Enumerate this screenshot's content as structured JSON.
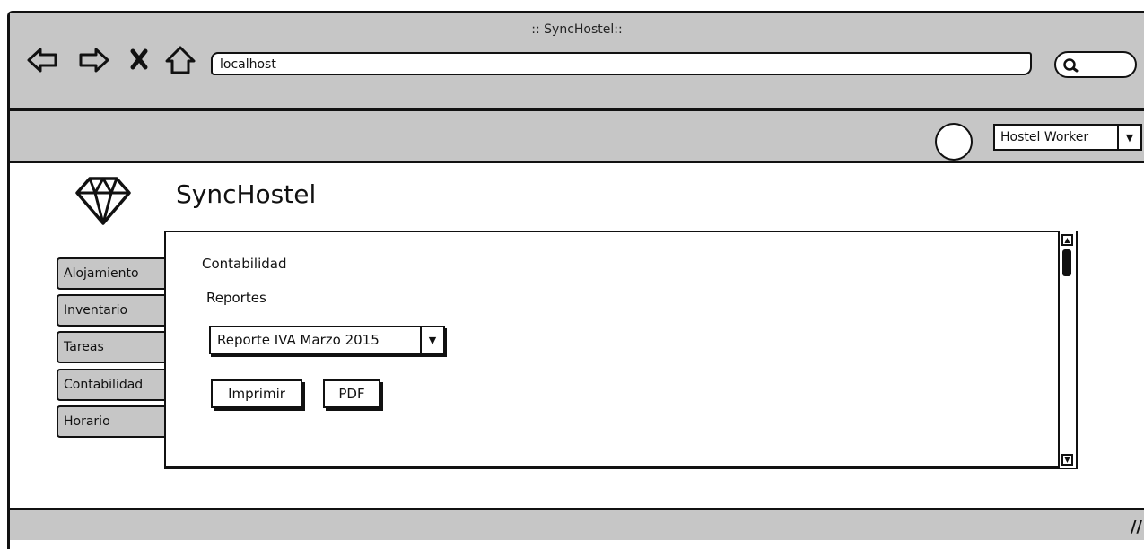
{
  "window": {
    "title": ":: SyncHostel::"
  },
  "browser": {
    "url": "localhost",
    "nav": [
      "back-icon",
      "forward-icon",
      "stop-icon",
      "home-icon"
    ],
    "search_icon": "search-icon"
  },
  "toolbar": {
    "user_menu_value": "Hostel Worker"
  },
  "app": {
    "title": "SyncHostel",
    "logo_icon": "diamond-icon"
  },
  "sidebar": {
    "items": [
      {
        "label": "Alojamiento"
      },
      {
        "label": "Inventario"
      },
      {
        "label": "Tareas"
      },
      {
        "label": "Contabilidad"
      },
      {
        "label": "Horario"
      }
    ]
  },
  "main": {
    "section_title": "Contabilidad",
    "subtitle": "Reportes",
    "report_select_value": "Reporte IVA Marzo 2015",
    "print_label": "Imprimir",
    "pdf_label": "PDF"
  },
  "colors": {
    "chrome_gray": "#c6c6c6",
    "ink": "#111111",
    "background": "#ffffff"
  }
}
